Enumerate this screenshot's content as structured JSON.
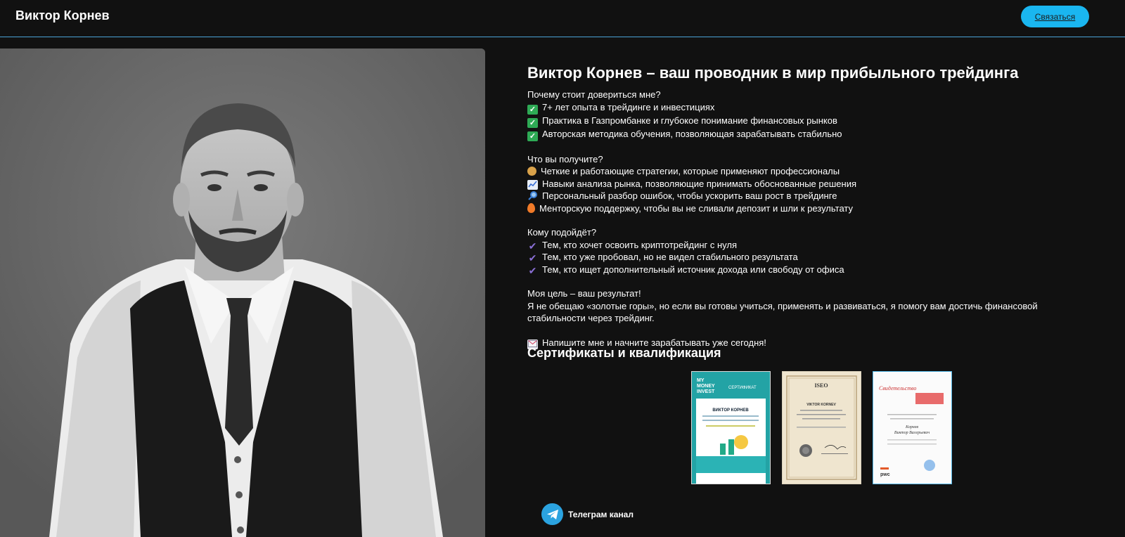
{
  "header": {
    "brand": "Виктор Корнев",
    "contact_label": "Связаться"
  },
  "colors": {
    "accent": "#1ab6f0",
    "header_line": "#4aa3d8",
    "background": "#111111"
  },
  "main": {
    "title": "Виктор Корнев – ваш проводник в мир прибыльного трейдинга",
    "why": {
      "heading": "Почему стоит довериться мне?",
      "items": [
        "7+ лет опыта в трейдинге и инвестициях",
        "Практика в Газпромбанке и глубокое понимание финансовых рынков",
        "Авторская методика обучения, позволяющая зарабатывать стабильно"
      ]
    },
    "get": {
      "heading": "Что вы получите?",
      "items": [
        {
          "icon": "money-bag-icon",
          "text": "Четкие и работающие стратегии, которые применяют профессионалы"
        },
        {
          "icon": "chart-icon",
          "text": "Навыки анализа рынка, позволяющие принимать обоснованные решения"
        },
        {
          "icon": "magnifier-icon",
          "text": "Персональный разбор ошибок, чтобы ускорить ваш рост в трейдинге"
        },
        {
          "icon": "fire-icon",
          "text": "Менторскую поддержку, чтобы вы не сливали депозит и шли к результату"
        }
      ]
    },
    "who": {
      "heading": "Кому подойдёт?",
      "items": [
        "Тем, кто хочет освоить криптотрейдинг с нуля",
        "Тем, кто уже пробовал, но не видел стабильного результата",
        "Тем, кто ищет дополнительный источник дохода или свободу от офиса"
      ]
    },
    "goal": {
      "heading": "Моя цель – ваш результат!",
      "text": "Я не обещаю «золотые горы», но если вы готовы учиться, применять и развиваться, я помогу вам достичь финансовой стабильности через трейдинг."
    },
    "cta": "Напишите мне и начните зарабатывать уже сегодня!"
  },
  "certificates": {
    "heading": "Сертификаты и квалификация",
    "items": [
      {
        "brand_line1": "MY",
        "brand_line2": "MONEY",
        "brand_line3": "INVEST",
        "title": "СЕРТИФИКАТ",
        "name": "ВИКТОР КОРНЕВ"
      },
      {
        "logo": "ISEO",
        "name": "VIKTOR KORNEV"
      },
      {
        "title": "Свидетельство",
        "name_line1": "Корнев",
        "name_line2": "Виктор Валерьевич",
        "logo": "pwc"
      }
    ]
  },
  "telegram": {
    "label": "Телеграм канал"
  }
}
